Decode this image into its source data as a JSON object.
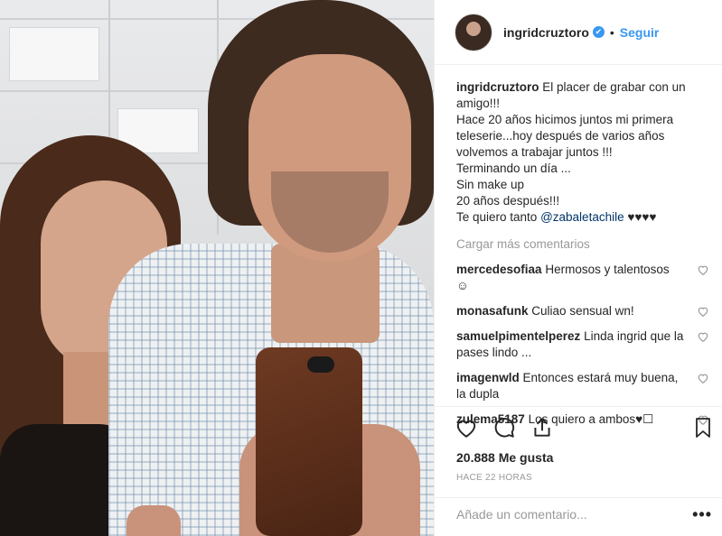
{
  "post": {
    "username": "ingridcruztoro",
    "verified_badge": "✔",
    "separator": "•",
    "follow_label": "Seguir"
  },
  "caption": {
    "username": "ingridcruztoro",
    "text": "El placer de grabar con un amigo!!!\nHace 20 años hicimos juntos mi primera teleserie...hoy después de varios años volvemos a trabajar juntos !!!\nTerminando un día ...\nSin make up\n20 años después!!!\nTe quiero tanto ",
    "mention": "@zabaletachile",
    "hearts": " ♥♥♥♥"
  },
  "load_more_label": "Cargar más comentarios",
  "comments": [
    {
      "user": "mercedesofiaa",
      "text": "Hermosos y talentosos ☺"
    },
    {
      "user": "monasafunk",
      "text": "Culiao sensual wn!"
    },
    {
      "user": "samuelpimentelperez",
      "text": "Linda ingrid que la pases lindo ..."
    },
    {
      "user": "imagenwld",
      "text": "Entonces estará muy buena, la dupla"
    },
    {
      "user": "zulema5187",
      "text": "Los quiero a ambos♥☐"
    }
  ],
  "likes_text": "20.888 Me gusta",
  "time_text": "HACE 22 HORAS",
  "add_comment_placeholder": "Añade un comentario...",
  "more_options": "•••",
  "icons": [
    "heart-icon",
    "comment-icon",
    "share-icon",
    "bookmark-icon"
  ],
  "colors": {
    "link": "#3897f0",
    "text": "#262626",
    "muted": "#999999",
    "verified": "#3897f0"
  }
}
